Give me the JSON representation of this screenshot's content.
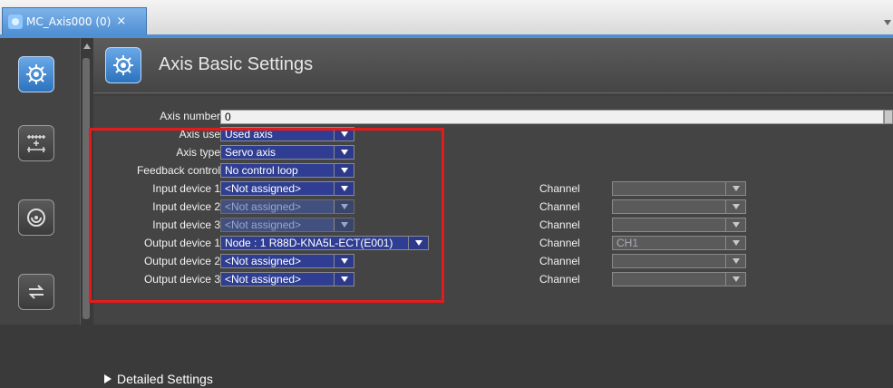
{
  "tab": {
    "title": "MC_Axis000 (0)",
    "close_label": "×"
  },
  "header": {
    "title": "Axis Basic Settings"
  },
  "fields": {
    "axis_number": {
      "label": "Axis number",
      "value": "0"
    },
    "axis_use": {
      "label": "Axis use",
      "value": "Used axis"
    },
    "axis_type": {
      "label": "Axis type",
      "value": "Servo axis"
    },
    "feedback_control": {
      "label": "Feedback control",
      "value": "No control loop"
    },
    "input1": {
      "label": "Input device 1",
      "value": "<Not assigned>"
    },
    "input2": {
      "label": "Input device 2",
      "value": "<Not assigned>"
    },
    "input3": {
      "label": "Input device 3",
      "value": "<Not assigned>"
    },
    "output1": {
      "label": "Output device 1",
      "value": "Node : 1 R88D-KNA5L-ECT(E001)"
    },
    "output2": {
      "label": "Output device 2",
      "value": "<Not assigned>"
    },
    "output3": {
      "label": "Output device 3",
      "value": "<Not assigned>"
    }
  },
  "channels": {
    "label": "Channel",
    "values": [
      "",
      "",
      "",
      "CH1",
      "",
      ""
    ]
  },
  "detailed": {
    "label": "Detailed Settings"
  },
  "colors": {
    "highlight": "#e31b1b",
    "accent": "#2b72bd"
  }
}
